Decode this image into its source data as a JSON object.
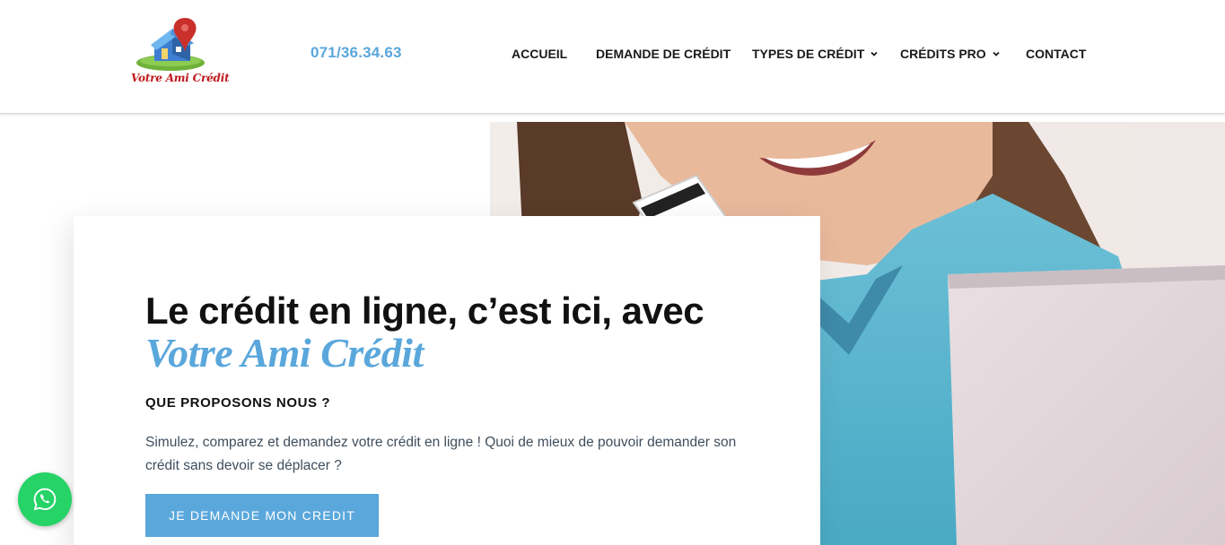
{
  "header": {
    "logo_text": "Votre Ami Crédit",
    "phone": "071/36.34.63",
    "nav": [
      {
        "label": "ACCUEIL",
        "dropdown": false
      },
      {
        "label": "DEMANDE DE CRÉDIT",
        "dropdown": false
      },
      {
        "label": "TYPES DE CRÉDIT",
        "dropdown": true
      },
      {
        "label": "CRÉDITS PRO",
        "dropdown": true
      },
      {
        "label": "CONTACT",
        "dropdown": false
      }
    ]
  },
  "hero": {
    "headline_main": "Le crédit en ligne, c’est ici, avec ",
    "headline_accent": "Votre Ami Crédit",
    "subheading": "QUE PROPOSONS NOUS ?",
    "description": "Simulez, comparez et demandez votre crédit en ligne !  Quoi de mieux de pouvoir demander son crédit sans devoir se déplacer ?",
    "cta_label": "JE DEMANDE MON CREDIT",
    "photo_alt": "smiling-woman-with-credit-card-and-laptop"
  },
  "colors": {
    "accent": "#5aa7dc",
    "text_dark": "#111111",
    "body_text": "#3f4e5c",
    "whatsapp": "#25d366",
    "logo_red": "#c0171d"
  },
  "icons": {
    "whatsapp": "whatsapp-icon",
    "chevron": "chevron-down-icon"
  }
}
